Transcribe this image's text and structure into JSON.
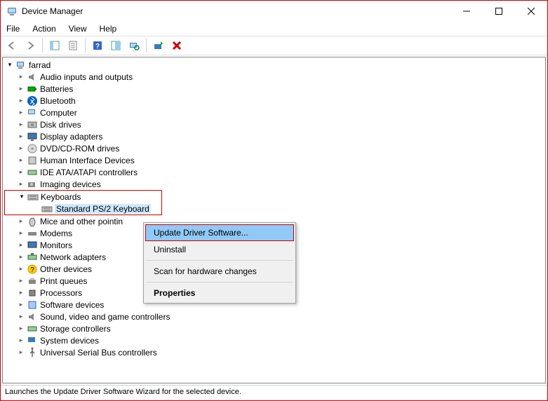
{
  "window": {
    "title": "Device Manager"
  },
  "menubar": [
    "File",
    "Action",
    "View",
    "Help"
  ],
  "tree": {
    "root": "farrad",
    "items": [
      "Audio inputs and outputs",
      "Batteries",
      "Bluetooth",
      "Computer",
      "Disk drives",
      "Display adapters",
      "DVD/CD-ROM drives",
      "Human Interface Devices",
      "IDE ATA/ATAPI controllers",
      "Imaging devices",
      "Keyboards",
      "Mice and other pointing devices",
      "Modems",
      "Monitors",
      "Network adapters",
      "Other devices",
      "Print queues",
      "Processors",
      "Software devices",
      "Sound, video and game controllers",
      "Storage controllers",
      "System devices",
      "Universal Serial Bus controllers"
    ],
    "child": "Standard PS/2 Keyboard",
    "truncated_11": "Mice and other pointin"
  },
  "context_menu": {
    "update": "Update Driver Software...",
    "uninstall": "Uninstall",
    "scan": "Scan for hardware changes",
    "properties": "Properties"
  },
  "statusbar": "Launches the Update Driver Software Wizard for the selected device."
}
